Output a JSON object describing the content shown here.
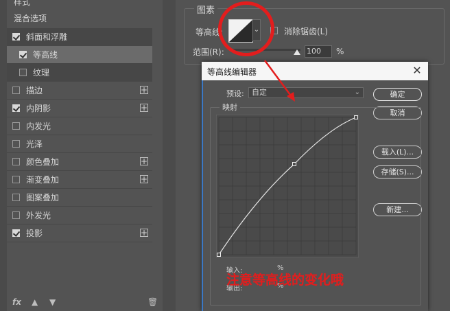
{
  "left_panel": {
    "header_styles": "样式",
    "header_blending": "混合选项",
    "items": [
      {
        "label": "斜面和浮雕",
        "checked": true,
        "plus": false
      },
      {
        "label": "等高线",
        "checked": true,
        "plus": false
      },
      {
        "label": "纹理",
        "checked": false,
        "plus": false
      },
      {
        "label": "描边",
        "checked": false,
        "plus": true
      },
      {
        "label": "内阴影",
        "checked": true,
        "plus": true
      },
      {
        "label": "内发光",
        "checked": false,
        "plus": false
      },
      {
        "label": "光泽",
        "checked": false,
        "plus": false
      },
      {
        "label": "颜色叠加",
        "checked": false,
        "plus": true
      },
      {
        "label": "渐变叠加",
        "checked": false,
        "plus": true
      },
      {
        "label": "图案叠加",
        "checked": false,
        "plus": false
      },
      {
        "label": "外发光",
        "checked": false,
        "plus": false
      },
      {
        "label": "投影",
        "checked": true,
        "plus": true
      }
    ],
    "footer_fx": "fx"
  },
  "options": {
    "group_title": "图素",
    "contour_label": "等高线:",
    "anti_alias_label": "消除锯齿(L)",
    "range_label": "范围(R):",
    "range_value": "100",
    "range_unit": "%"
  },
  "dialog": {
    "title": "等高线编辑器",
    "preset_label": "预设:",
    "preset_value": "自定",
    "map_label": "映射",
    "input_label": "输入:",
    "output_label": "输出:",
    "percent": "%",
    "buttons": {
      "ok": "确定",
      "cancel": "取消",
      "load": "载入(L)...",
      "save": "存储(S)...",
      "new": "新建..."
    }
  },
  "annotation": "注意等高线的变化哦",
  "colors": {
    "panel_bg": "#535353",
    "highlight": "#e31d1d",
    "dialog_accent": "#3b78c4"
  }
}
